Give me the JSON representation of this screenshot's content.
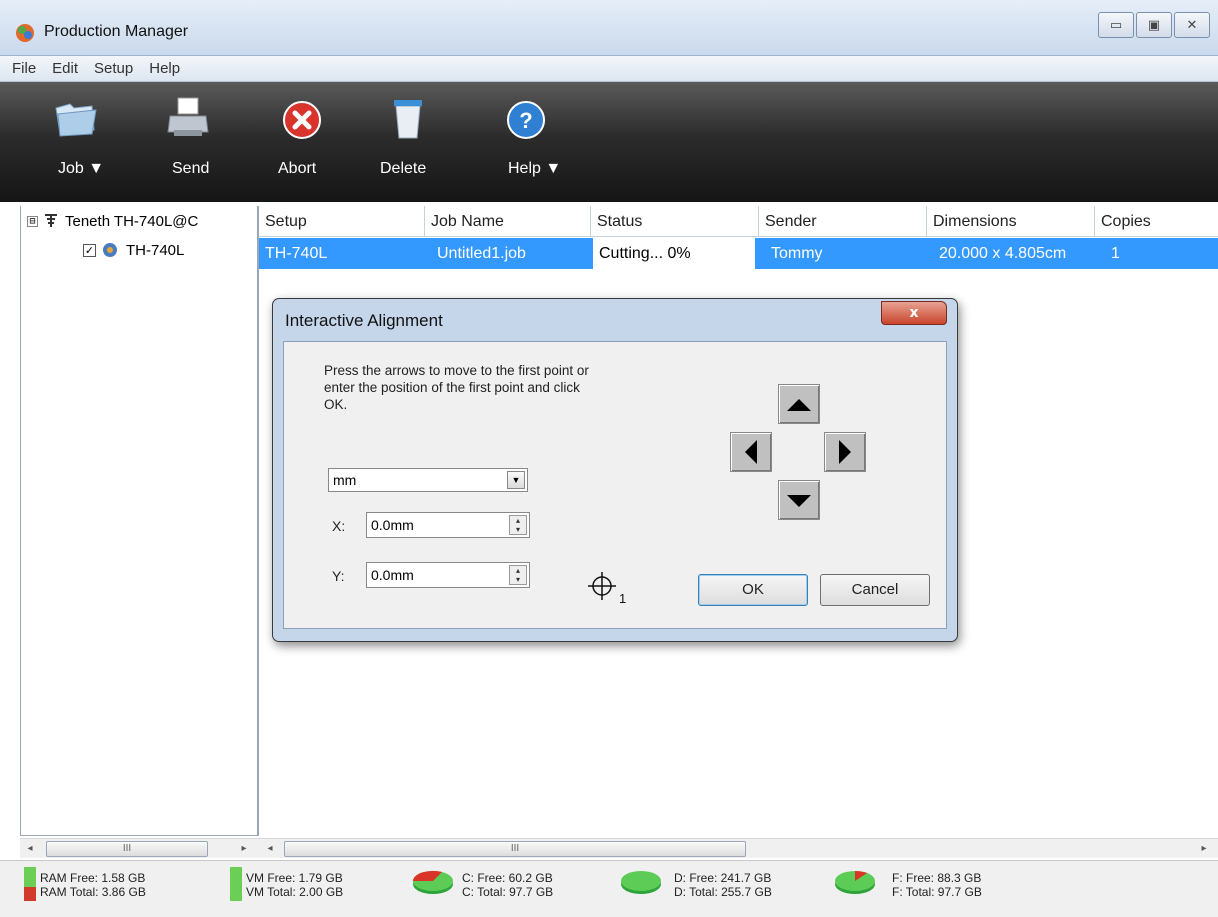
{
  "window": {
    "title": "Production Manager",
    "controls": {
      "minimize": "▭",
      "maximize": "▣",
      "close": "✕"
    }
  },
  "menu": [
    "File",
    "Edit",
    "Setup",
    "Help"
  ],
  "toolbar": {
    "job": "Job ▼",
    "send": "Send",
    "abort": "Abort",
    "delete": "Delete",
    "help": "Help ▼"
  },
  "tree": {
    "root_label": "Teneth TH-740L@C",
    "root_expander": "⊟",
    "child_label": "TH-740L",
    "child_checked": "✓"
  },
  "job_table": {
    "headers": [
      "Setup",
      "Job Name",
      "Status",
      "Sender",
      "Dimensions",
      "Copies"
    ],
    "rows": [
      {
        "setup": "TH-740L",
        "job_name": "Untitled1.job",
        "status": "Cutting... 0%",
        "sender": "Tommy",
        "dimensions": "20.000 x 4.805cm",
        "copies": "1"
      }
    ]
  },
  "scrollbars": {
    "left_arrow": "◂",
    "right_arrow": "▸",
    "grip": "III"
  },
  "status_bar": {
    "ram_free": "RAM Free: 1.58 GB",
    "ram_total": "RAM Total: 3.86 GB",
    "vm_free": "VM Free: 1.79 GB",
    "vm_total": "VM Total: 2.00 GB",
    "c_free": "C: Free: 60.2 GB",
    "c_total": "C: Total: 97.7 GB",
    "d_free": "D: Free: 241.7 GB",
    "d_total": "D: Total: 255.7 GB",
    "f_free": "F: Free: 88.3 GB",
    "f_total": "F: Total: 97.7 GB"
  },
  "dialog": {
    "title": "Interactive Alignment",
    "close_glyph": "x",
    "instructions": "Press the arrows to move to the first point or enter the position of the first point and click OK.",
    "unit": "mm",
    "x_label": "X:",
    "x_value": "0.0mm",
    "y_label": "Y:",
    "y_value": "0.0mm",
    "target_index": "1",
    "ok": "OK",
    "cancel": "Cancel",
    "spin_up": "▴",
    "spin_down": "▾",
    "select_arrow": "▼"
  }
}
